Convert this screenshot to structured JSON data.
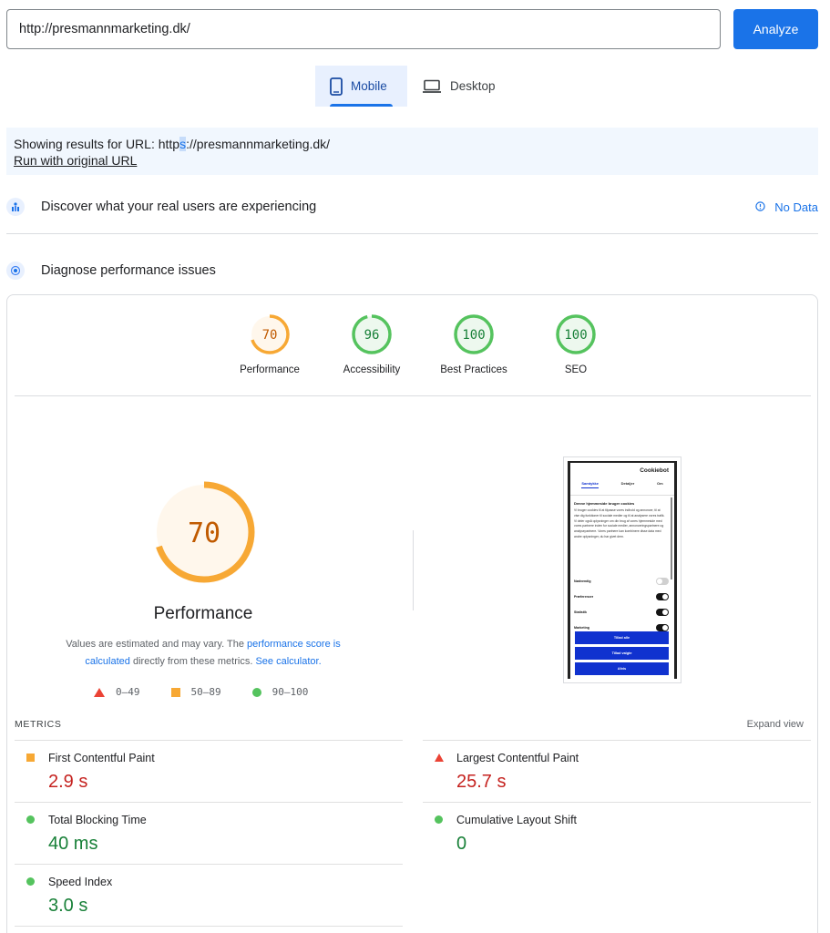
{
  "search": {
    "value": "http://presmannmarketing.dk/",
    "analyze_label": "Analyze"
  },
  "device_tabs": [
    {
      "label": "Mobile",
      "icon": "phone-icon",
      "active": true
    },
    {
      "label": "Desktop",
      "icon": "laptop-icon",
      "active": false
    }
  ],
  "info": {
    "prefix": "Showing results for URL: ",
    "url_start": "http",
    "url_highlight": "s",
    "url_rest": "://presmannmarketing.dk/",
    "run_original": "Run with original URL"
  },
  "real_users": {
    "title": "Discover what your real users are experiencing",
    "status": "No Data"
  },
  "diagnose": {
    "title": "Diagnose performance issues"
  },
  "scores": [
    {
      "label": "Performance",
      "value": "70",
      "color": "#f7a834",
      "text_color": "#c05a00",
      "bg": "#fff7ec"
    },
    {
      "label": "Accessibility",
      "value": "96",
      "color": "#55c35e",
      "text_color": "#188038",
      "bg": "#edf8ee"
    },
    {
      "label": "Best Practices",
      "value": "100",
      "color": "#55c35e",
      "text_color": "#188038",
      "bg": "#edf8ee"
    },
    {
      "label": "SEO",
      "value": "100",
      "color": "#55c35e",
      "text_color": "#188038",
      "bg": "#edf8ee"
    }
  ],
  "performance": {
    "score": "70",
    "score_fraction": 0.7,
    "title": "Performance",
    "desc_1": "Values are estimated and may vary. The ",
    "desc_link_1": "performance score is calculated",
    "desc_2": " directly from these metrics. ",
    "desc_link_2": "See calculator."
  },
  "legend": [
    {
      "range": "0–49",
      "shape": "triangle"
    },
    {
      "range": "50–89",
      "shape": "square"
    },
    {
      "range": "90–100",
      "shape": "circle"
    }
  ],
  "screenshot": {
    "logo": "Cookiebot",
    "tabs": [
      "Samtykke",
      "Detaljer",
      "Om"
    ],
    "heading": "Denne hjemmeside bruger cookies",
    "text": "Vi bruger cookies til at tilpasse vores indhold og annoncer, til at vise dig funktioner til sociale medier og til at analysere vores trafik. Vi deler også oplysninger om din brug af vores hjemmeside med vores partnere inden for sociale medier, annonceringspartnere og analysepartnere. Vores partnere kan kombinere disse data med andre oplysninger, du har givet dem.",
    "toggles": [
      "Nødvendig",
      "Præferencer",
      "Statistik",
      "Marketing"
    ],
    "buttons": [
      "Tillad alle",
      "Tillad valgte",
      "Afvis"
    ]
  },
  "metrics": {
    "heading": "METRICS",
    "expand": "Expand view",
    "items": [
      {
        "label": "First Contentful Paint",
        "value": "2.9 s",
        "rating": "average"
      },
      {
        "label": "Largest Contentful Paint",
        "value": "25.7 s",
        "rating": "fail"
      },
      {
        "label": "Total Blocking Time",
        "value": "40 ms",
        "rating": "pass"
      },
      {
        "label": "Cumulative Layout Shift",
        "value": "0",
        "rating": "pass"
      },
      {
        "label": "Speed Index",
        "value": "3.0 s",
        "rating": "pass"
      }
    ]
  },
  "colors": {
    "accent": "#1a73e8",
    "fail": "#eb4335",
    "average": "#f7a834",
    "pass": "#55c35e"
  }
}
